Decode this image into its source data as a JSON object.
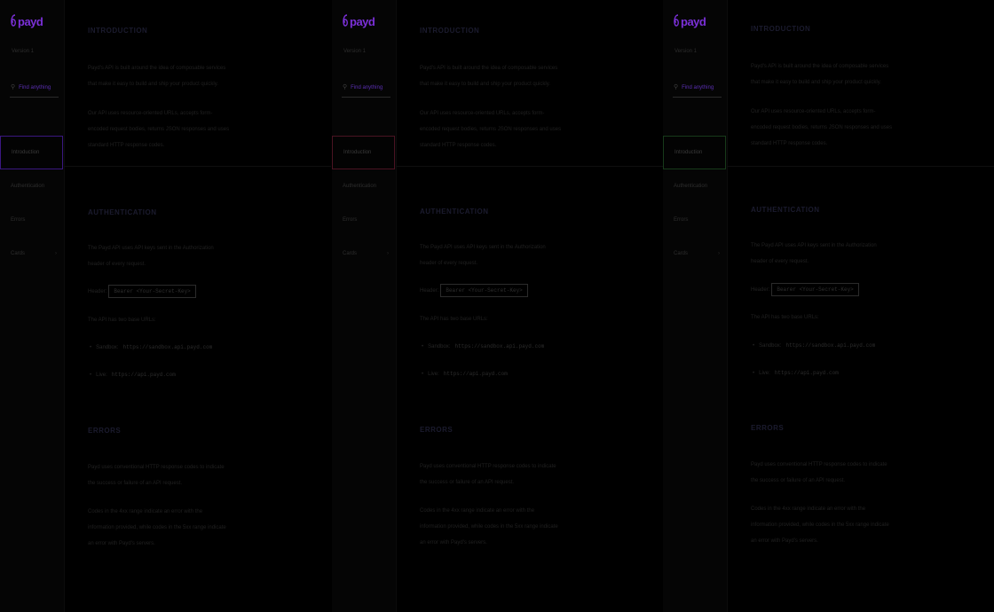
{
  "brand": {
    "logo_text": "payd",
    "accent_colors": [
      "#7b30d8",
      "#c0306a",
      "#2fa84a"
    ]
  },
  "sidebar": {
    "version": "Version 1",
    "search_placeholder": "Find anything",
    "items": [
      {
        "label": "Introduction",
        "active": true
      },
      {
        "label": "Authentication",
        "active": false
      },
      {
        "label": "Errors",
        "active": false
      },
      {
        "label": "Cards",
        "active": false,
        "has_chevron": true
      }
    ]
  },
  "sections": {
    "introduction": {
      "title": "INTRODUCTION",
      "paragraphs": [
        "Payd's API is built around the idea of composable services that make it easy to build and ship your product quickly.",
        "Our API uses resource-oriented URLs, accepts form-encoded request bodies, returns JSON responses and uses standard HTTP response codes."
      ]
    },
    "authentication": {
      "title": "AUTHENTICATION",
      "paragraphs": [
        "The Payd API uses API keys sent in the Authorization header of every request."
      ],
      "header_label": "Header:",
      "header_value": "Bearer <Your-Secret-Key>",
      "base_urls_label": "The API has two base URLs:",
      "base_urls": [
        {
          "env": "Sandbox:",
          "url": "https://sandbox.api.payd.com"
        },
        {
          "env": "Live:",
          "url": "https://api.payd.com"
        }
      ]
    },
    "errors": {
      "title": "ERRORS",
      "paragraphs": [
        "Payd uses conventional HTTP response codes to indicate the success or failure of an API request.",
        "Codes in the 4xx range indicate an error with the information provided, while codes in the 5xx range indicate an error with Payd's servers."
      ]
    }
  }
}
